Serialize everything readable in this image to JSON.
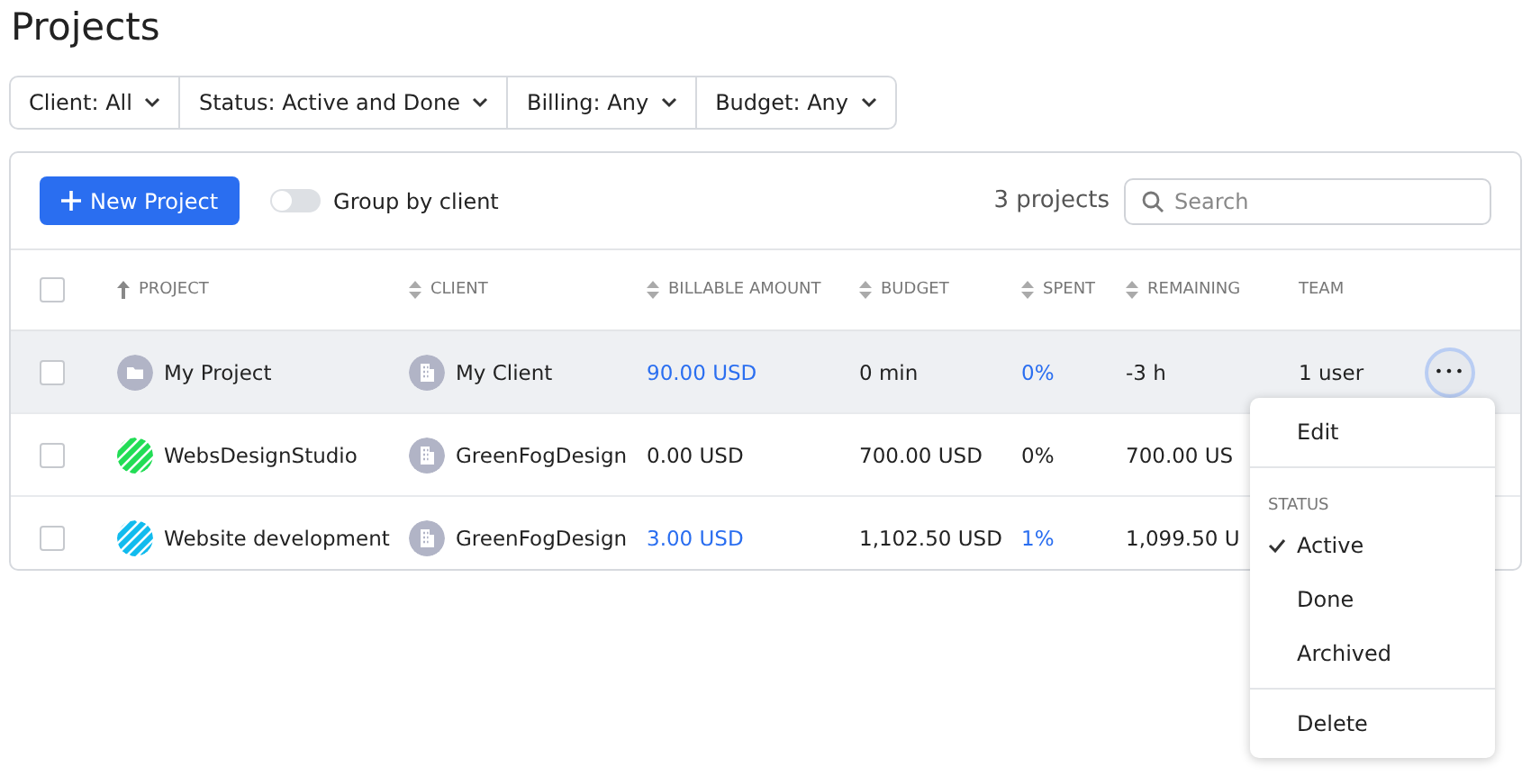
{
  "title": "Projects",
  "filters": [
    "Client: All",
    "Status: Active and Done",
    "Billing: Any",
    "Budget: Any"
  ],
  "toolbar": {
    "new_button": "New Project",
    "group_toggle": {
      "label": "Group by client",
      "on": false
    },
    "count": "3 projects",
    "search": {
      "placeholder": "Search"
    }
  },
  "table": {
    "select_all": {
      "checked": false
    },
    "columns": [
      {
        "label": "PROJECT",
        "sorted": true,
        "sortable": true
      },
      {
        "label": "CLIENT",
        "sorted": false,
        "sortable": true
      },
      {
        "label": "BILLABLE AMOUNT",
        "sorted": false,
        "sortable": true
      },
      {
        "label": "BUDGET",
        "sorted": false,
        "sortable": true
      },
      {
        "label": "SPENT",
        "sorted": false,
        "sortable": true
      },
      {
        "label": "REMAINING",
        "sorted": false,
        "sortable": true
      },
      {
        "label": "TEAM",
        "sorted": false,
        "sortable": false
      }
    ],
    "rows": [
      {
        "checked": false,
        "highlighted": true,
        "avatar": {
          "kind": "folder"
        },
        "project": "My Project",
        "client": "My Client",
        "billable": {
          "text": "90.00 USD",
          "link": true
        },
        "budget": "0 min",
        "spent": {
          "text": "0%",
          "link": true
        },
        "remaining": "-3 h",
        "team": "1 user",
        "menu_button": "•••"
      },
      {
        "checked": false,
        "highlighted": false,
        "avatar": {
          "kind": "stripes",
          "color": "#22dd55"
        },
        "project": "WebsDesignStudio",
        "client": "GreenFogDesign",
        "billable": {
          "text": "0.00 USD",
          "link": false
        },
        "budget": "700.00 USD",
        "spent": {
          "text": "0%",
          "link": false
        },
        "remaining": "700.00 US"
      },
      {
        "checked": false,
        "highlighted": false,
        "avatar": {
          "kind": "stripes",
          "color": "#11bbee"
        },
        "project": "Website development",
        "client": "GreenFogDesign",
        "billable": {
          "text": "3.00 USD",
          "link": true
        },
        "budget": "1,102.50 USD",
        "spent": {
          "text": "1%",
          "link": true
        },
        "remaining": "1,099.50 U"
      }
    ]
  },
  "menu": {
    "items": [
      {
        "kind": "action",
        "label": "Edit"
      },
      {
        "kind": "divider"
      },
      {
        "kind": "heading",
        "label": "STATUS"
      },
      {
        "kind": "option",
        "label": "Active",
        "selected": true
      },
      {
        "kind": "option",
        "label": "Done",
        "selected": false
      },
      {
        "kind": "option",
        "label": "Archived",
        "selected": false
      },
      {
        "kind": "divider"
      },
      {
        "kind": "action",
        "label": "Delete"
      }
    ]
  }
}
